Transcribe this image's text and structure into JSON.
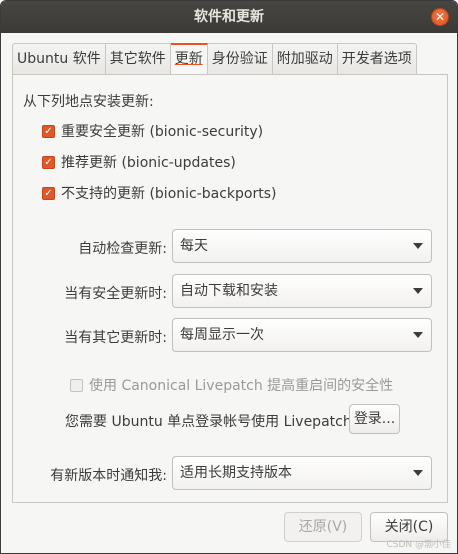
{
  "window": {
    "title": "软件和更新",
    "close_icon": "close-icon"
  },
  "tabs": [
    {
      "label": "Ubuntu 软件"
    },
    {
      "label": "其它软件"
    },
    {
      "label": "更新"
    },
    {
      "label": "身份验证"
    },
    {
      "label": "附加驱动"
    },
    {
      "label": "开发者选项"
    }
  ],
  "updates": {
    "sources_label": "从下列地点安装更新:",
    "sources": [
      {
        "label": "重要安全更新 (bionic-security)",
        "checked": true
      },
      {
        "label": "推荐更新 (bionic-updates)",
        "checked": true
      },
      {
        "label": "不支持的更新 (bionic-backports)",
        "checked": true
      }
    ],
    "auto_check": {
      "label": "自动检查更新:",
      "value": "每天"
    },
    "security_updates": {
      "label": "当有安全更新时:",
      "value": "自动下载和安装"
    },
    "other_updates": {
      "label": "当有其它更新时:",
      "value": "每周显示一次"
    },
    "livepatch": {
      "label": "使用 Canonical Livepatch 提高重启间的安全性",
      "checked": false
    },
    "login_prompt": "您需要 Ubuntu 单点登录帐号使用 Livepatch",
    "login_button": "登录...",
    "notify": {
      "label": "有新版本时通知我:",
      "value": "适用长期支持版本"
    }
  },
  "footer": {
    "revert_button": "还原(V)",
    "close_button": "关闭(C)"
  },
  "watermark": "CSDN @渤小佳"
}
